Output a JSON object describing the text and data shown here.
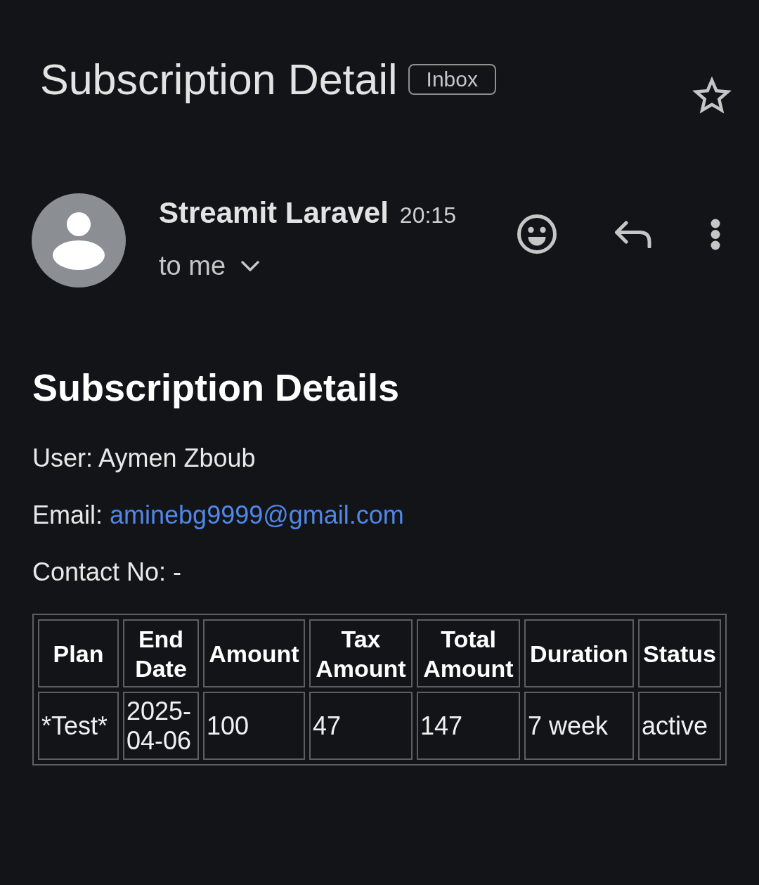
{
  "header": {
    "subject": "Subscription Detail",
    "label": "Inbox",
    "starred": false
  },
  "message": {
    "sender": "Streamit Laravel",
    "time": "20:15",
    "recipient": "to me"
  },
  "body": {
    "heading": "Subscription Details",
    "fields": [
      {
        "kind": "text",
        "label": "User:",
        "value": "Aymen Zboub"
      },
      {
        "kind": "link",
        "label": "Email:",
        "value": "aminebg9999@gmail.com"
      },
      {
        "kind": "text",
        "label": "Contact No:",
        "value": "-"
      }
    ],
    "table": {
      "columns": [
        "Plan",
        "End Date",
        "Amount",
        "Tax Amount",
        "Total Amount",
        "Duration",
        "Status"
      ],
      "rows": [
        [
          "*Test*",
          "2025-04-06",
          "100",
          "47",
          "147",
          "7 week",
          "active"
        ]
      ]
    }
  }
}
